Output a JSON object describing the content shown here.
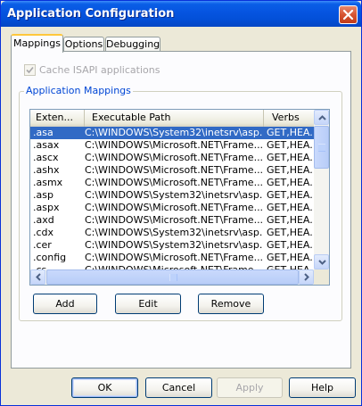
{
  "window": {
    "title": "Application Configuration",
    "colors": {
      "titlebar": "#0654e0",
      "selection": "#316ac5",
      "group_title": "#0046d5"
    }
  },
  "tabs": [
    {
      "label": "Mappings",
      "active": true
    },
    {
      "label": "Options",
      "active": false
    },
    {
      "label": "Debugging",
      "active": false
    }
  ],
  "cache_isapi": {
    "label": "Cache ISAPI applications",
    "checked": true,
    "enabled": false
  },
  "group": {
    "title": "Application Mappings"
  },
  "listview": {
    "columns": [
      "Exten...",
      "Executable Path",
      "Verbs"
    ],
    "rows": [
      {
        "ext": ".asa",
        "path": "C:\\WINDOWS\\System32\\inetsrv\\asp....",
        "verbs": "GET,HEA...",
        "selected": true
      },
      {
        "ext": ".asax",
        "path": "C:\\WINDOWS\\Microsoft.NET\\Frame...",
        "verbs": "GET,HEA...",
        "selected": false
      },
      {
        "ext": ".ascx",
        "path": "C:\\WINDOWS\\Microsoft.NET\\Frame...",
        "verbs": "GET,HEA...",
        "selected": false
      },
      {
        "ext": ".ashx",
        "path": "C:\\WINDOWS\\Microsoft.NET\\Frame...",
        "verbs": "GET,HEA...",
        "selected": false
      },
      {
        "ext": ".asmx",
        "path": "C:\\WINDOWS\\Microsoft.NET\\Frame...",
        "verbs": "GET,HEA...",
        "selected": false
      },
      {
        "ext": ".asp",
        "path": "C:\\WINDOWS\\System32\\inetsrv\\asp....",
        "verbs": "GET,HEA...",
        "selected": false
      },
      {
        "ext": ".aspx",
        "path": "C:\\WINDOWS\\Microsoft.NET\\Frame...",
        "verbs": "GET,HEA...",
        "selected": false
      },
      {
        "ext": ".axd",
        "path": "C:\\WINDOWS\\Microsoft.NET\\Frame...",
        "verbs": "GET,HEA...",
        "selected": false
      },
      {
        "ext": ".cdx",
        "path": "C:\\WINDOWS\\System32\\inetsrv\\asp....",
        "verbs": "GET,HEA...",
        "selected": false
      },
      {
        "ext": ".cer",
        "path": "C:\\WINDOWS\\System32\\inetsrv\\asp....",
        "verbs": "GET,HEA...",
        "selected": false
      },
      {
        "ext": ".config",
        "path": "C:\\WINDOWS\\Microsoft.NET\\Frame...",
        "verbs": "GET,HEA...",
        "selected": false
      },
      {
        "ext": ".cs",
        "path": "C:\\WINDOWS\\Microsoft.NET\\Frame...",
        "verbs": "GET,HEA...",
        "selected": false
      }
    ]
  },
  "mapping_buttons": {
    "add": "Add",
    "edit": "Edit",
    "remove": "Remove"
  },
  "dialog_buttons": {
    "ok": "OK",
    "cancel": "Cancel",
    "apply": "Apply",
    "help": "Help"
  },
  "icons": {
    "close": "close-icon",
    "checkmark": "checkmark-icon",
    "scroll_up": "arrow-up-icon",
    "scroll_down": "arrow-down-icon",
    "scroll_left": "arrow-left-icon",
    "scroll_right": "arrow-right-icon"
  }
}
